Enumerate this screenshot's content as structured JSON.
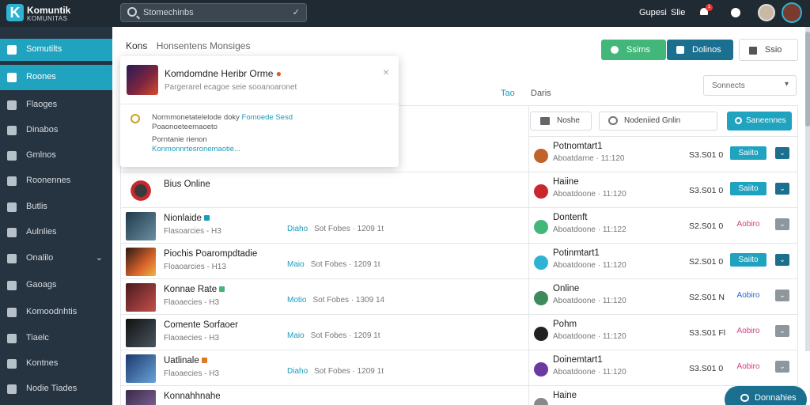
{
  "app": {
    "logo_name": "Komuntik",
    "logo_tagline": "KOMUNITAS"
  },
  "topbar": {
    "search_placeholder": "Stomechinbs",
    "user_links": [
      "Gupesi",
      "Slie"
    ],
    "notification_count": "1"
  },
  "sidebar": {
    "items": [
      {
        "label": "Somutilts",
        "icon": "grid-icon"
      },
      {
        "label": "Roones",
        "icon": "star-icon"
      },
      {
        "label": "Flaoges",
        "icon": "flag-icon"
      },
      {
        "label": "Dinabos",
        "icon": "puzzle-icon"
      },
      {
        "label": "Gmlnos",
        "icon": "chat-icon"
      },
      {
        "label": "Roonennes",
        "icon": "users-icon"
      },
      {
        "label": "Butlis",
        "icon": "list-icon"
      },
      {
        "label": "Aulnlies",
        "icon": "doc-icon"
      },
      {
        "label": "Onalilo",
        "icon": "box-icon"
      },
      {
        "label": "Gaoags",
        "icon": "tag-icon"
      },
      {
        "label": "Komoodnhtis",
        "icon": "pin-icon"
      },
      {
        "label": "Tiaelc",
        "icon": "card-icon"
      },
      {
        "label": "Kontnes",
        "icon": "image-icon"
      },
      {
        "label": "Nodie Tiades",
        "icon": "trade-icon"
      }
    ]
  },
  "header": {
    "crumb_primary": "Kons",
    "crumb_secondary": "Honsentens Monsiges",
    "btn_green": "Ssims",
    "btn_teal": "Dolinos",
    "btn_outline": "Ssio"
  },
  "popup": {
    "title": "Komdomdne Heribr Orme",
    "subtitle": "Pargerarel ecagoe seie sooanoaronet",
    "line1": "Normmonetatelelode doky",
    "line1_link": "Fomoede Sesd",
    "line2": "Poaonoeteemaoeto",
    "line3": "Porntanie rienon",
    "line4_link": "Konmonnrtesronemaotie..."
  },
  "tabs": {
    "active": "Tao",
    "inactive": "Daris"
  },
  "sort": {
    "selected": "Sonnects"
  },
  "toolbar": {
    "btn1": "Noshe",
    "btn2": "Nodeniied Gnlin",
    "btn3": "Saneennes"
  },
  "left_rows": [
    {
      "name": "Bius Online",
      "meta": "",
      "tag": "",
      "info": ""
    },
    {
      "name": "Nionlaide",
      "meta": "Flasoarcies - H3",
      "tag": "Diaho",
      "info": "Sot Fobes · 1209 1t"
    },
    {
      "name": "Piochis Poarompdtadie",
      "meta": "Floaoarcies - H13",
      "tag": "Maio",
      "info": "Sot Fobes · 1209 1t"
    },
    {
      "name": "Konnae Rate",
      "meta": "Flaoaecies - H3",
      "tag": "Motio",
      "info": "Sot Fobes · 1309 14"
    },
    {
      "name": "Comente Sorfaoer",
      "meta": "Flaoaecies - H3",
      "tag": "Maio",
      "info": "Sot Fobes · 1209 1t"
    },
    {
      "name": "Uatlinale",
      "meta": "Flaoaecies - H3",
      "tag": "Diaho",
      "info": "Sot Fobes · 1209 1t"
    },
    {
      "name": "Konnahhnahe",
      "meta": "",
      "tag": "",
      "info": ""
    }
  ],
  "right_rows": [
    {
      "name": "Potnomtart1",
      "meta": "Aboatdarne · 11:120",
      "price": "S3.S01 0",
      "action": "Saiito",
      "action_style": "button",
      "drop": "teal"
    },
    {
      "name": "Haiine",
      "meta": "Aboatdoone · 11:120",
      "price": "S3.S01 0",
      "action": "Saiito",
      "action_style": "button",
      "drop": "teal"
    },
    {
      "name": "Dontenft",
      "meta": "Aboatdoone · 11:122",
      "price": "S2.S01 0",
      "action": "Aobiro",
      "action_style": "pink",
      "drop": "grey"
    },
    {
      "name": "Potinmtart1",
      "meta": "Aboatdoone · 11:120",
      "price": "S2.S01 0",
      "action": "Saiito",
      "action_style": "button",
      "drop": "teal"
    },
    {
      "name": "Online",
      "meta": "Aboatdoone · 11:120",
      "price": "S2.S01 N",
      "action": "Aobiro",
      "action_style": "blue",
      "drop": "grey"
    },
    {
      "name": "Pohm",
      "meta": "Aboatdoone · 11:120",
      "price": "S3.S01 Fl",
      "action": "Aobiro",
      "action_style": "pink",
      "drop": "grey"
    },
    {
      "name": "Doinemtart1",
      "meta": "Aboatdoone · 11:120",
      "price": "S3.S01 0",
      "action": "Aobiro",
      "action_style": "pink",
      "drop": "grey"
    },
    {
      "name": "Haine",
      "meta": "",
      "price": "",
      "action": "",
      "action_style": "none",
      "drop": "none"
    }
  ],
  "chat": {
    "label": "Donnahies"
  },
  "colors": {
    "accent": "#1fa3bf",
    "sidebar": "#263340",
    "topbar": "#1f2a33",
    "green": "#43b77a",
    "dark_teal": "#1b6f8f"
  }
}
